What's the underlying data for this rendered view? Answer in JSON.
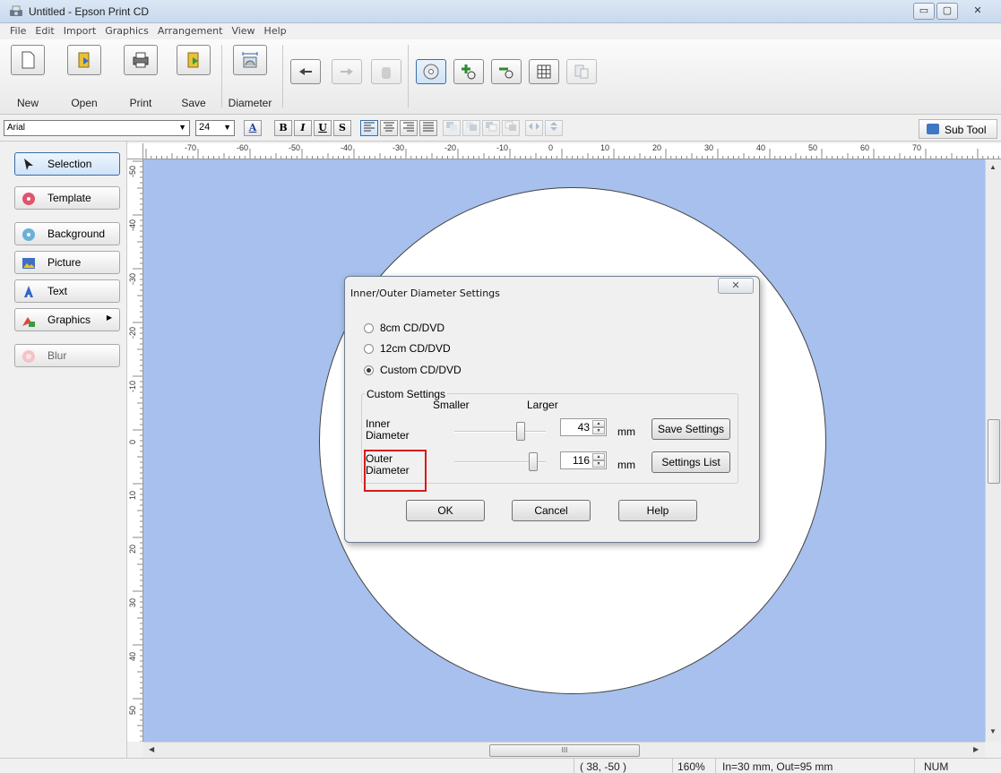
{
  "window": {
    "title": "Untitled - Epson Print CD",
    "minimize": "▭",
    "maximize": "▢",
    "close": "✕"
  },
  "menu": [
    "File",
    "Edit",
    "Import",
    "Graphics",
    "Arrangement",
    "View",
    "Help"
  ],
  "toolbar": {
    "new": "New",
    "open": "Open",
    "print": "Print",
    "save": "Save",
    "diameter": "Diameter"
  },
  "format": {
    "font": "Arial",
    "size": "24",
    "bold": "B",
    "italic": "I",
    "underline": "U",
    "shadow": "S",
    "sub_tool": "Sub Tool"
  },
  "panel": {
    "selection": "Selection",
    "template": "Template",
    "background": "Background",
    "picture": "Picture",
    "text": "Text",
    "graphics": "Graphics",
    "blur": "Blur"
  },
  "ruler": {
    "top": [
      "-70",
      "-60",
      "-50",
      "-40",
      "-30",
      "-20",
      "-10",
      "0",
      "10",
      "20",
      "30",
      "40",
      "50",
      "60",
      "70"
    ],
    "left": [
      "-50",
      "-40",
      "-30",
      "-20",
      "-10",
      "0",
      "10",
      "20",
      "30",
      "40",
      "50"
    ]
  },
  "hscroll_grip": "III",
  "dialog": {
    "title": "Inner/Outer Diameter Settings",
    "options": [
      "8cm CD/DVD",
      "12cm CD/DVD",
      "Custom CD/DVD"
    ],
    "selected_option": 2,
    "group_title": "Custom Settings",
    "smaller": "Smaller",
    "larger": "Larger",
    "inner_label": "Inner Diameter",
    "outer_label": "Outer Diameter",
    "inner_value": "43",
    "outer_value": "116",
    "unit": "mm",
    "save_settings": "Save Settings",
    "settings_list": "Settings List",
    "ok": "OK",
    "cancel": "Cancel",
    "help": "Help"
  },
  "status": {
    "coords": "( 38, -50 )",
    "zoom": "160%",
    "diameters": "In=30 mm, Out=95 mm",
    "num": "NUM"
  }
}
